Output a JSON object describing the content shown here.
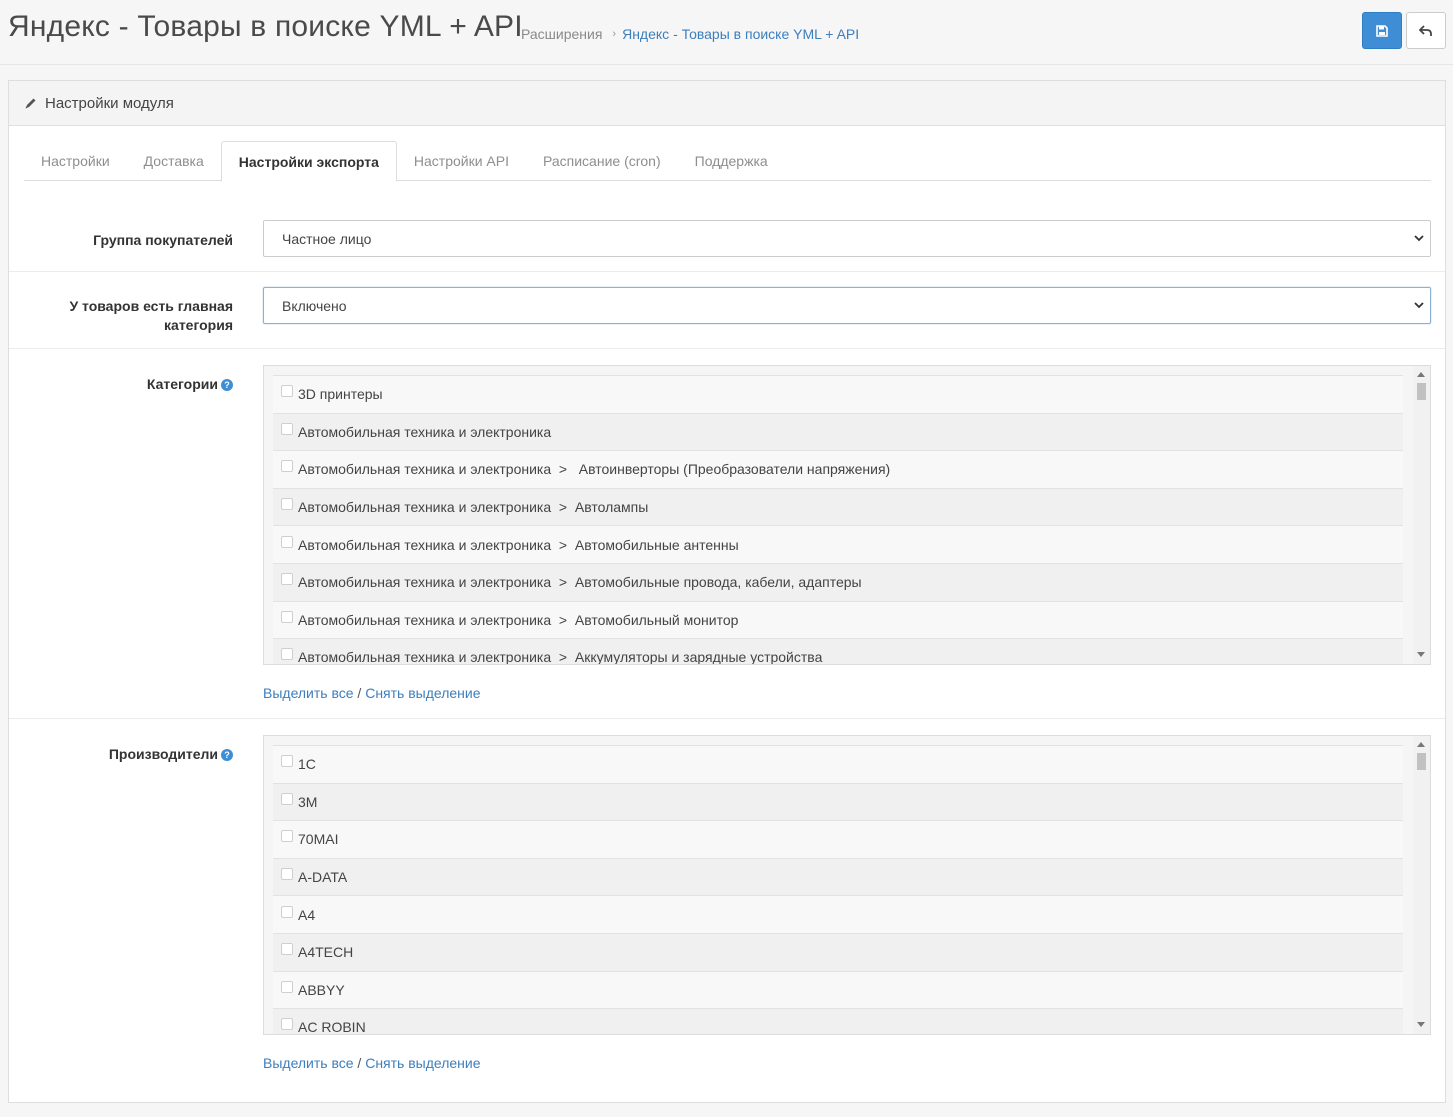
{
  "header": {
    "title": "Яндекс - Товары в поиске YML + API",
    "breadcrumbs": [
      {
        "label": "Расширения"
      },
      {
        "label": "Яндекс - Товары в поиске YML + API"
      }
    ],
    "breadcrumb_separator": "›",
    "save_icon": "floppy-disk-icon",
    "back_icon": "reply-arrow-icon"
  },
  "panel": {
    "heading_icon": "pencil-icon",
    "heading": "Настройки модуля"
  },
  "tabs": [
    {
      "label": "Настройки",
      "active": false
    },
    {
      "label": "Доставка",
      "active": false
    },
    {
      "label": "Настройки экспорта",
      "active": true
    },
    {
      "label": "Настройки API",
      "active": false
    },
    {
      "label": "Расписание (cron)",
      "active": false
    },
    {
      "label": "Поддержка",
      "active": false
    }
  ],
  "form": {
    "customer_group": {
      "label": "Группа покупателей",
      "value": "Частное лицо"
    },
    "main_category": {
      "label_line1": "У товаров есть главная",
      "label_line2": "категория",
      "value": "Включено"
    },
    "categories": {
      "label": "Категории",
      "help": "?",
      "items": [
        "3D принтеры",
        "Автомобильная техника и электроника",
        "Автомобильная техника и электроника  >   Автоинверторы (Преобразователи напряжения)",
        "Автомобильная техника и электроника  >  Автолампы",
        "Автомобильная техника и электроника  >  Автомобильные антенны",
        "Автомобильная техника и электроника  >  Автомобильные провода, кабели, адаптеры",
        "Автомобильная техника и электроника  >  Автомобильный монитор",
        "Автомобильная техника и электроника  >  Аккумуляторы и зарядные устройства"
      ],
      "select_all": "Выделить все",
      "divider": " / ",
      "deselect": "Снять выделение"
    },
    "manufacturers": {
      "label": "Производители",
      "help": "?",
      "items": [
        "1C",
        "3M",
        "70MAI",
        "A-DATA",
        "A4",
        "A4TECH",
        "ABBYY",
        "AC ROBIN"
      ],
      "select_all": "Выделить все",
      "divider": " / ",
      "deselect": "Снять выделение"
    }
  },
  "colors": {
    "primary": "#3f8ed5",
    "link": "#3d7ebd"
  }
}
